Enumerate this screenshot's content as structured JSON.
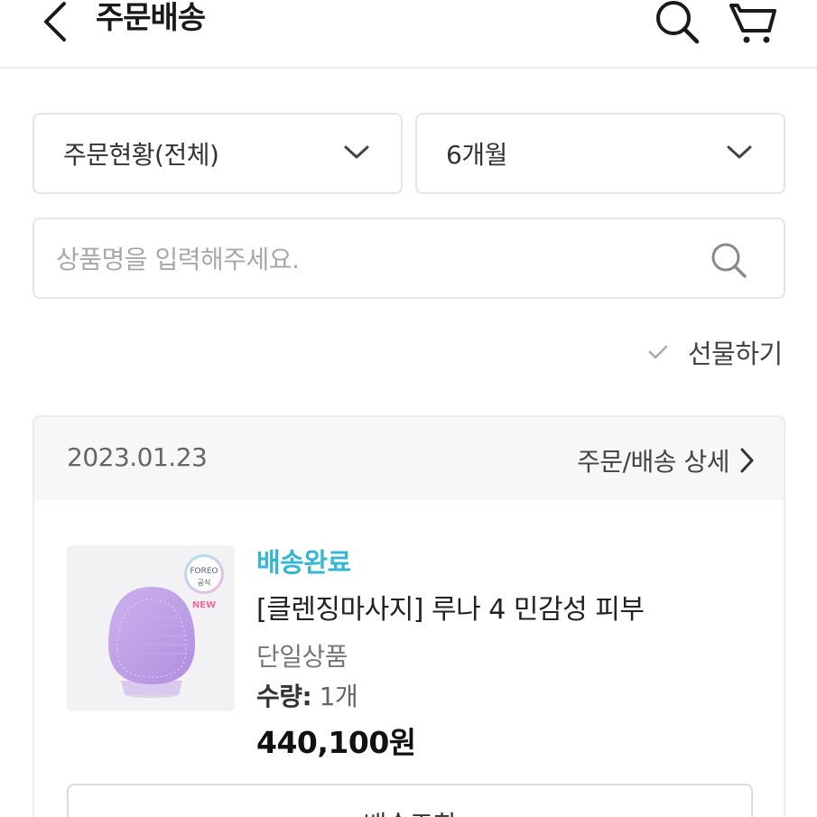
{
  "header": {
    "title": "주문배송",
    "back_icon": "chevron-left-icon",
    "search_icon": "search-icon",
    "cart_icon": "cart-icon"
  },
  "filters": {
    "status_value": "주문현황(전체)",
    "period_value": "6개월"
  },
  "search": {
    "placeholder": "상품명을 입력해주세요.",
    "value": ""
  },
  "gift": {
    "label": "선물하기",
    "checked": false
  },
  "order": {
    "date": "2023.01.23",
    "detail_link": "주문/배송 상세",
    "item": {
      "image_brand": "FOREO",
      "image_badge": "공식",
      "image_new": "NEW",
      "status": "배송완료",
      "name": "[클렌징마사지] 루나 4 민감성 피부",
      "option": "단일상품",
      "qty_label": "수량:",
      "qty_value": "1개",
      "price": "440,100원"
    },
    "track_button": "배송조회"
  },
  "colors": {
    "status": "#35b6d3",
    "border": "#e6e6e6",
    "card_head_bg": "#f7f7f7"
  }
}
